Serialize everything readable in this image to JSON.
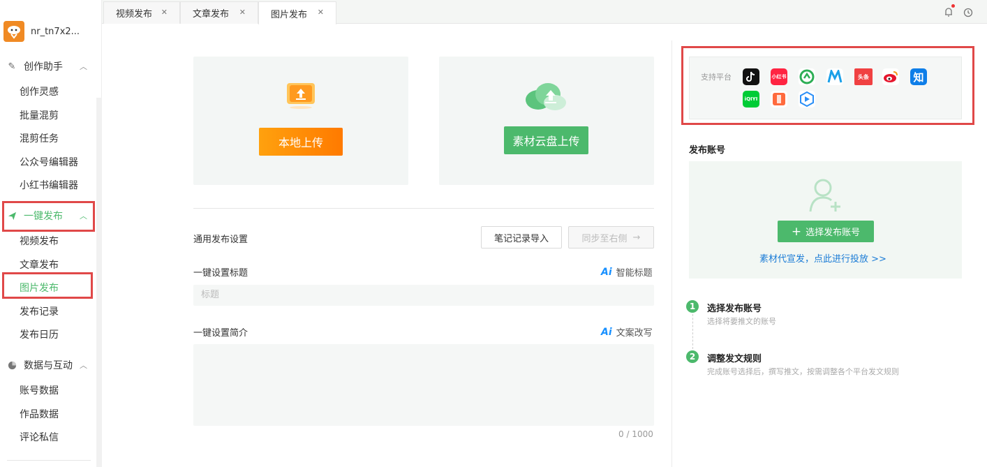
{
  "user": {
    "name": "nr_tn7x2..."
  },
  "sidebar": {
    "groups": [
      {
        "label": "创作助手",
        "icon": "pen-icon",
        "items": [
          "创作灵感",
          "批量混剪",
          "混剪任务",
          "公众号编辑器",
          "小红书编辑器"
        ]
      },
      {
        "label": "一键发布",
        "icon": "send-icon",
        "items": [
          "视频发布",
          "文章发布",
          "图片发布",
          "发布记录",
          "发布日历"
        ]
      },
      {
        "label": "数据与互动",
        "icon": "pie-chart-icon",
        "items": [
          "账号数据",
          "作品数据",
          "评论私信"
        ]
      }
    ]
  },
  "tabs": [
    {
      "label": "视频发布"
    },
    {
      "label": "文章发布"
    },
    {
      "label": "图片发布"
    }
  ],
  "upload": {
    "local_label": "本地上传",
    "cloud_label": "素材云盘上传"
  },
  "settings": {
    "title": "通用发布设置",
    "import_label": "笔记记录导入",
    "sync_label": "同步至右侧",
    "title_label": "一键设置标题",
    "ai_title_label": "智能标题",
    "title_placeholder": "标题",
    "desc_label": "一键设置简介",
    "ai_rewrite_label": "文案改写",
    "counter": "0 / 1000",
    "ai_mark": "Ai"
  },
  "right": {
    "platform_label": "支持平台",
    "platforms": [
      "douyin",
      "xiaohongshu",
      "shipinhao",
      "bilibili",
      "toutiao",
      "weibo",
      "zhihu",
      "iqiyi",
      "kuaishou",
      "tencent-video"
    ],
    "platform_texts": {
      "xiaohongshu": "小红书",
      "toutiao": "头条",
      "zhihu": "知",
      "iqiyi": "iQIYI"
    },
    "account_title": "发布账号",
    "select_account_label": "选择发布账号",
    "promo_link": "素材代宣发，点此进行投放 >>",
    "steps": [
      {
        "num": "1",
        "title": "选择发布账号",
        "desc": "选择将要推文的账号"
      },
      {
        "num": "2",
        "title": "调整发文规则",
        "desc": "完成账号选择后，撰写推文，按需调整各个平台发文规则"
      }
    ]
  },
  "colors": {
    "accent_green": "#4cb96c",
    "accent_orange": "#ff8a00",
    "highlight_red": "#e04848"
  }
}
